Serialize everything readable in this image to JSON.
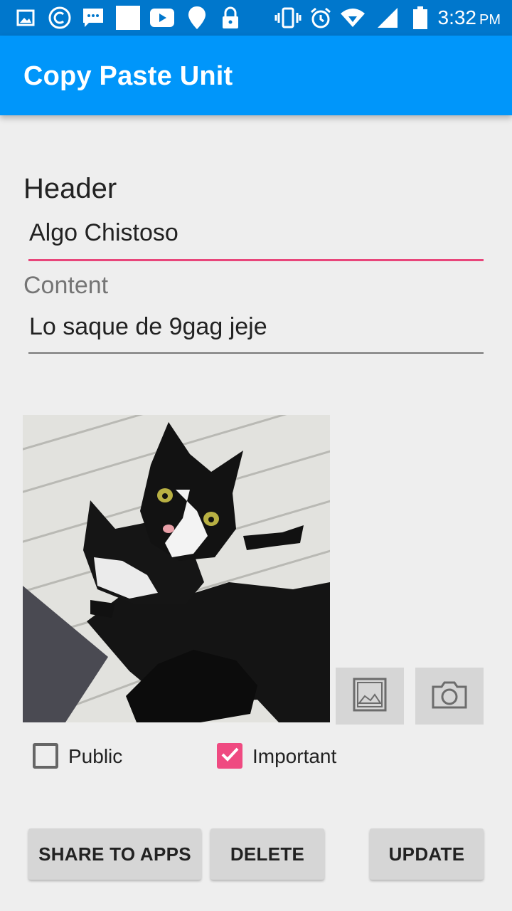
{
  "status_bar": {
    "time": "3:32",
    "ampm": "PM",
    "icons": [
      "image-icon",
      "copyright-icon",
      "sms-icon",
      "blank-notification-icon",
      "youtube-icon",
      "location-pin-icon",
      "lock-icon",
      "vibrate-icon",
      "alarm-icon",
      "wifi-icon",
      "signal-icon",
      "battery-icon"
    ]
  },
  "app_bar": {
    "title": "Copy Paste Unit"
  },
  "form": {
    "header_label": "Header",
    "header_value": "Algo Chistoso",
    "content_label": "Content",
    "content_value": "Lo saque de 9gag jeje"
  },
  "image": {
    "description_icon": "cat-photo"
  },
  "image_buttons": {
    "gallery_icon": "gallery-icon",
    "camera_icon": "camera-icon"
  },
  "options": {
    "public_label": "Public",
    "public_checked": false,
    "important_label": "Important",
    "important_checked": true
  },
  "actions": {
    "share_label": "SHARE TO APPS",
    "delete_label": "DELETE",
    "update_label": "UPDATE"
  },
  "colors": {
    "status_bar": "#0077cc",
    "app_bar": "#0096fa",
    "accent": "#ef4a81",
    "background": "#eeeeee"
  }
}
